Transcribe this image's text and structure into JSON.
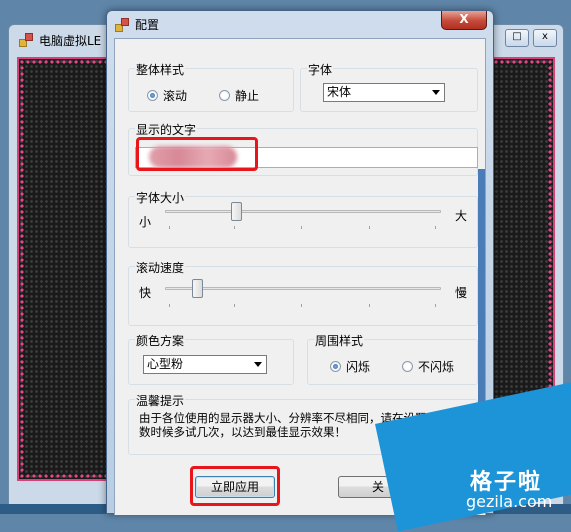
{
  "bg_window": {
    "title": "电脑虚拟LE",
    "controls": [
      "□",
      "x"
    ]
  },
  "dialog": {
    "title": "配置",
    "close_label": "X",
    "overall_style": {
      "label": "整体样式",
      "options": [
        {
          "label": "滚动",
          "selected": true
        },
        {
          "label": "静止",
          "selected": false
        }
      ]
    },
    "font": {
      "label": "字体",
      "value": "宋体"
    },
    "display_text": {
      "label": "显示的文字",
      "value": ""
    },
    "font_size": {
      "label": "字体大小",
      "min_label": "小",
      "max_label": "大",
      "level": 0.25
    },
    "scroll_speed": {
      "label": "滚动速度",
      "min_label": "快",
      "max_label": "慢",
      "level": 0.1
    },
    "color_scheme": {
      "label": "颜色方案",
      "value": "心型粉"
    },
    "border_style": {
      "label": "周围样式",
      "options": [
        {
          "label": "闪烁",
          "selected": true
        },
        {
          "label": "不闪烁",
          "selected": false
        }
      ]
    },
    "tips": {
      "label": "温馨提示",
      "text": "由于各位使用的显示器大小、分辨率不尽相同，请在设置上面的参数时候多试几次，以达到最佳显示效果！"
    },
    "apply_button": "立即应用",
    "close_button": "关"
  },
  "watermark": {
    "main": "格子啦",
    "sub": "gezila.com"
  },
  "colors": {
    "highlight": "#e8161a",
    "led_border": "#d8407a",
    "watermark_bg": "#1e94d8"
  }
}
